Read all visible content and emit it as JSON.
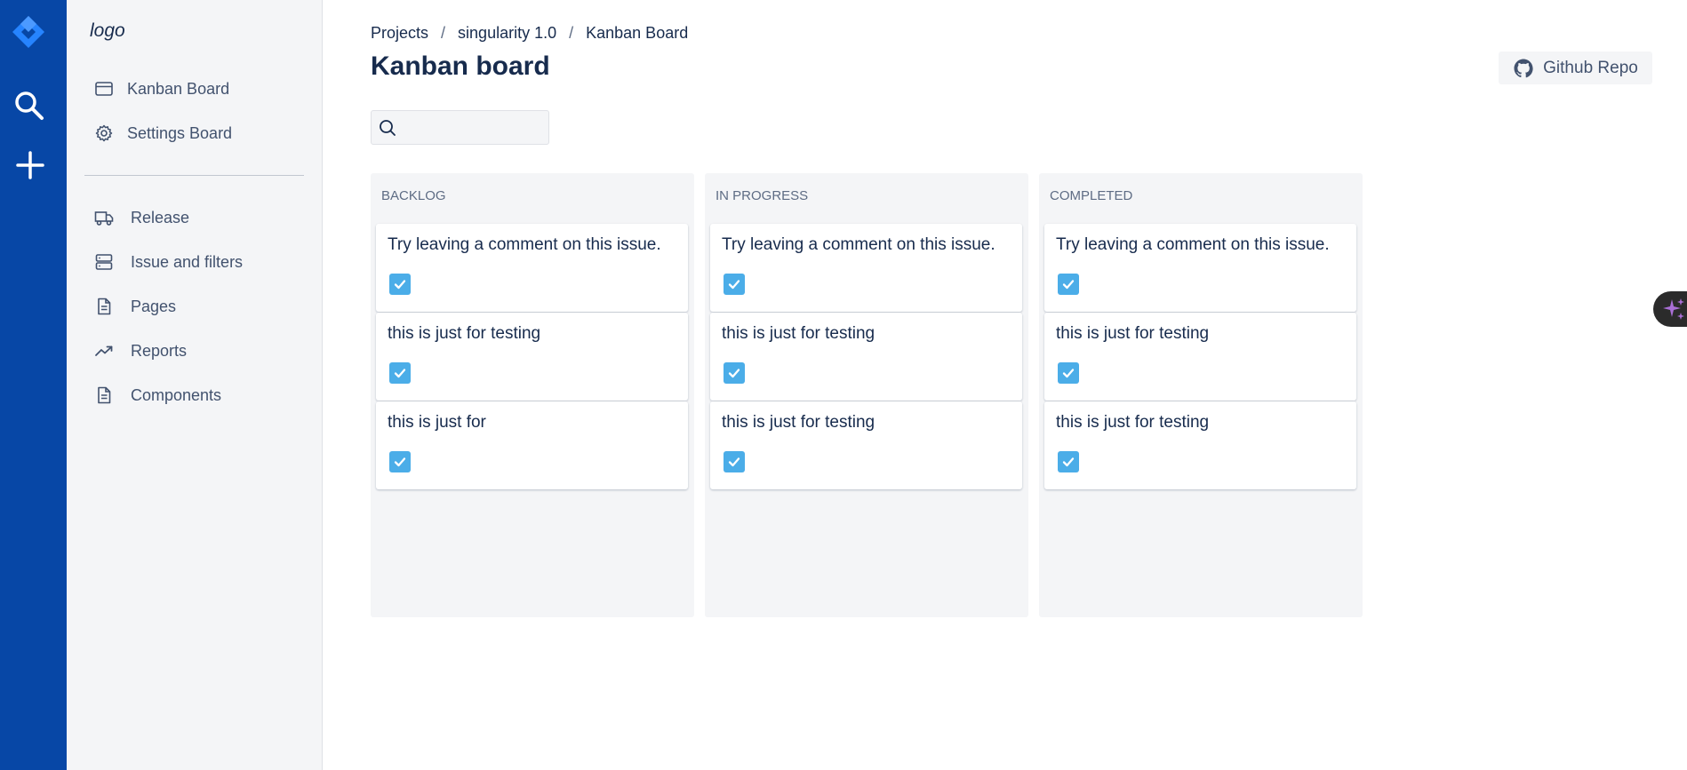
{
  "navbar": {
    "logo_icon": "jira-logo-icon",
    "search_icon": "search-icon",
    "create_icon": "plus-icon",
    "background": "#0747a6"
  },
  "sidebar": {
    "logo_text": "logo",
    "items": [
      {
        "label": "Kanban Board",
        "icon": "board-icon"
      },
      {
        "label": "Settings Board",
        "icon": "gear-icon"
      },
      {
        "label": "Release",
        "icon": "truck-icon"
      },
      {
        "label": "Issue and filters",
        "icon": "server-icon"
      },
      {
        "label": "Pages",
        "icon": "document-icon"
      },
      {
        "label": "Reports",
        "icon": "trending-up-icon"
      },
      {
        "label": "Components",
        "icon": "document-icon"
      }
    ]
  },
  "breadcrumb": [
    "Projects",
    "singularity 1.0",
    "Kanban Board"
  ],
  "page": {
    "title": "Kanban board"
  },
  "github": {
    "label": "Github Repo",
    "icon": "github-icon"
  },
  "search": {
    "value": "",
    "placeholder": ""
  },
  "board": {
    "columns": [
      {
        "title": "BACKLOG",
        "cards": [
          {
            "text": "Try leaving a comment on this issue.",
            "type": "task"
          },
          {
            "text": "this is just for testing",
            "type": "task"
          },
          {
            "text": "this is just for",
            "type": "task"
          }
        ]
      },
      {
        "title": "IN PROGRESS",
        "cards": [
          {
            "text": "Try leaving a comment on this issue.",
            "type": "task"
          },
          {
            "text": "this is just for testing",
            "type": "task"
          },
          {
            "text": "this is just for testing",
            "type": "task"
          }
        ]
      },
      {
        "title": "COMPLETED",
        "cards": [
          {
            "text": "Try leaving a comment on this issue.",
            "type": "task"
          },
          {
            "text": "this is just for testing",
            "type": "task"
          },
          {
            "text": "this is just for testing",
            "type": "task"
          }
        ]
      }
    ]
  },
  "colors": {
    "task_check": "#4bade8",
    "column_bg": "#f4f5f7",
    "assistant_accent": "#a96fd6"
  }
}
